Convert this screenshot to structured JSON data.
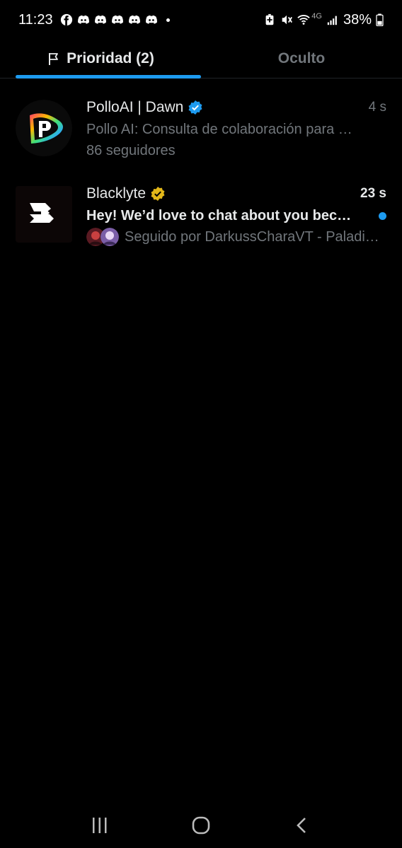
{
  "status_bar": {
    "time": "11:23",
    "notification_icons": [
      "facebook-icon",
      "discord-icon",
      "discord-icon",
      "discord-icon",
      "discord-icon",
      "discord-icon"
    ],
    "system_icons": [
      "battery-saver-icon",
      "mute-icon",
      "wifi-icon",
      "signal-icon"
    ],
    "network_label": "4G",
    "battery_percent": "38%"
  },
  "tabs": [
    {
      "label": "Prioridad (2)",
      "active": true,
      "icon": "flag-icon"
    },
    {
      "label": "Oculto",
      "active": false
    }
  ],
  "conversations": [
    {
      "name": "PolloAI | Dawn",
      "verified": "blue",
      "time": "4 s",
      "snippet": "Pollo AI: Consulta de colaboración para …",
      "meta": "86 seguidores",
      "unread": false,
      "avatar_icon": "polloai-logo-icon"
    },
    {
      "name": "Blacklyte",
      "verified": "gold",
      "time": "23 s",
      "snippet": "Hey! We’d love to chat about you bec…",
      "meta": "Seguido por DarkussCharaVT - Paladi…",
      "unread": true,
      "avatar_icon": "blacklyte-logo-icon"
    }
  ],
  "colors": {
    "accent": "#1d9bf0",
    "verified_blue": "#1d9bf0",
    "verified_gold": "#e2b719",
    "muted_text": "#71767b"
  },
  "nav_bar": [
    "recent-apps-icon",
    "home-icon",
    "back-icon"
  ]
}
